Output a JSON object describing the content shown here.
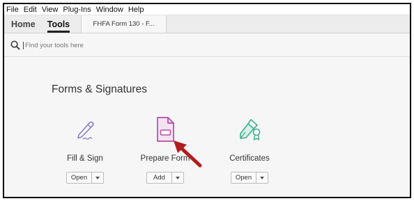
{
  "menu": [
    "File",
    "Edit",
    "View",
    "Plug-Ins",
    "Window",
    "Help"
  ],
  "tabs": {
    "home": "Home",
    "tools": "Tools",
    "document": "FHFA Form 130 - F..."
  },
  "search": {
    "placeholder": "Find your tools here"
  },
  "section": {
    "title": "Forms & Signatures"
  },
  "tools": [
    {
      "label": "Fill & Sign",
      "action": "Open",
      "icon": "fill-sign-icon",
      "color": "#8A7CCB"
    },
    {
      "label": "Prepare Form",
      "action": "Add",
      "icon": "prepare-form-icon",
      "color": "#B24FA0"
    },
    {
      "label": "Certificates",
      "action": "Open",
      "icon": "certificates-icon",
      "color": "#3DAE8E"
    }
  ],
  "colors": {
    "annotation_arrow": "#B01E1E"
  }
}
